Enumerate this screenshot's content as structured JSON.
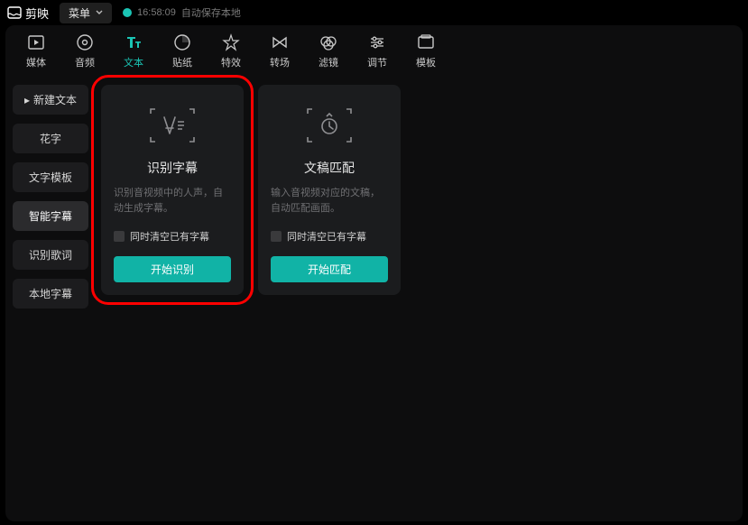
{
  "header": {
    "app_name": "剪映",
    "menu_label": "菜单",
    "status_time": "16:58:09",
    "status_text": "自动保存本地"
  },
  "nav": {
    "items": [
      {
        "label": "媒体"
      },
      {
        "label": "音频"
      },
      {
        "label": "文本"
      },
      {
        "label": "贴纸"
      },
      {
        "label": "特效"
      },
      {
        "label": "转场"
      },
      {
        "label": "滤镜"
      },
      {
        "label": "调节"
      },
      {
        "label": "模板"
      }
    ]
  },
  "sidebar": {
    "items": [
      {
        "label": "新建文本",
        "icon": "plus"
      },
      {
        "label": "花字"
      },
      {
        "label": "文字模板"
      },
      {
        "label": "智能字幕"
      },
      {
        "label": "识别歌词"
      },
      {
        "label": "本地字幕"
      }
    ]
  },
  "cards": {
    "recognize": {
      "title": "识别字幕",
      "desc": "识别音视频中的人声，自动生成字幕。",
      "checkbox_label": "同时清空已有字幕",
      "button_label": "开始识别"
    },
    "match": {
      "title": "文稿匹配",
      "desc": "输入音视频对应的文稿，自动匹配画面。",
      "checkbox_label": "同时清空已有字幕",
      "button_label": "开始匹配"
    }
  }
}
